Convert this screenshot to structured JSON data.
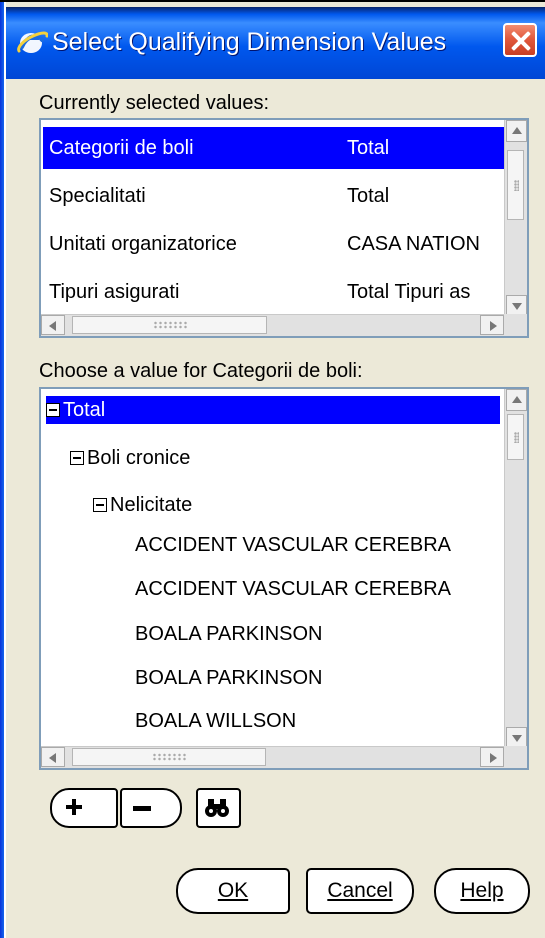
{
  "window": {
    "title": "Select Qualifying Dimension Values",
    "title_icon": "ie-icon",
    "colors": {
      "titlebar": "#0058ee",
      "selection": "#0000ff",
      "face": "#ece9d8",
      "close": "#e25a3e"
    }
  },
  "selected_values": {
    "label": "Currently selected values:",
    "rows": [
      {
        "name": "Categorii de boli",
        "value": "Total",
        "selected": true
      },
      {
        "name": "Specialitati",
        "value": "Total",
        "selected": false
      },
      {
        "name": "Unitati organizatorice",
        "value": "CASA NATION",
        "selected": false
      },
      {
        "name": "Tipuri asigurati",
        "value": "Total Tipuri as",
        "selected": false
      }
    ]
  },
  "choice": {
    "label": "Choose a value for Categorii de boli:",
    "tree": [
      {
        "text": "Total",
        "level": 0,
        "expanded": true,
        "selected": true
      },
      {
        "text": "Boli cronice",
        "level": 1,
        "expanded": true,
        "selected": false
      },
      {
        "text": "Nelicitate",
        "level": 2,
        "expanded": true,
        "selected": false
      },
      {
        "text": "ACCIDENT VASCULAR CEREBRA",
        "level": 3,
        "expanded": false,
        "selected": false
      },
      {
        "text": "ACCIDENT VASCULAR CEREBRA",
        "level": 3,
        "expanded": false,
        "selected": false
      },
      {
        "text": "BOALA PARKINSON",
        "level": 3,
        "expanded": false,
        "selected": false
      },
      {
        "text": "BOALA PARKINSON",
        "level": 3,
        "expanded": false,
        "selected": false
      },
      {
        "text": "BOALA WILLSON",
        "level": 3,
        "expanded": false,
        "selected": false
      }
    ]
  },
  "toolbar": {
    "expand_icon": "plus-icon",
    "collapse_icon": "minus-icon",
    "find_icon": "binoculars-icon"
  },
  "buttons": {
    "ok": "OK",
    "cancel": "Cancel",
    "help": "Help"
  }
}
